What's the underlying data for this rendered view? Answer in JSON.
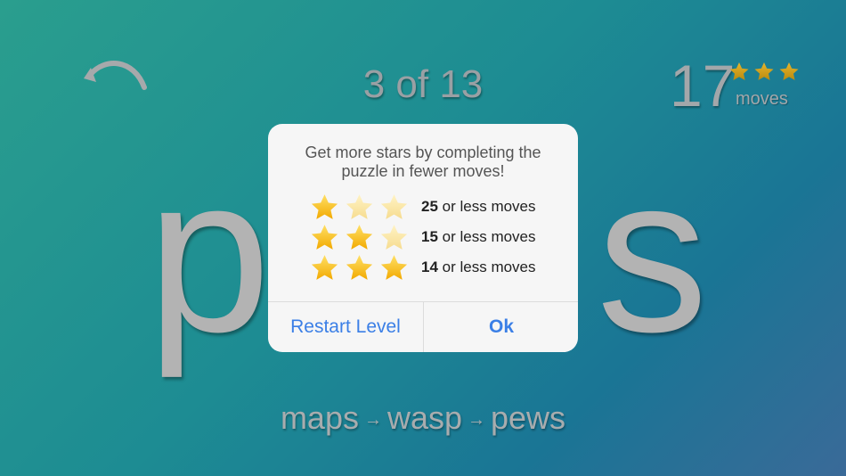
{
  "hud": {
    "level": "3 of 13",
    "moves_count": "17",
    "moves_label": "moves",
    "stars_earned": 3
  },
  "board": {
    "left_letter": "p",
    "right_letter": "s"
  },
  "chain": {
    "words": [
      "maps",
      "wasp",
      "pews"
    ],
    "arrow": "→"
  },
  "dialog": {
    "message_line1": "Get more stars by completing the",
    "message_line2": "puzzle in fewer moves!",
    "rows": [
      {
        "stars": 1,
        "moves": "25",
        "suffix": " or less moves"
      },
      {
        "stars": 2,
        "moves": "15",
        "suffix": " or less moves"
      },
      {
        "stars": 3,
        "moves": "14",
        "suffix": " or less moves"
      }
    ],
    "restart_label": "Restart Level",
    "ok_label": "Ok"
  },
  "colors": {
    "star_gold": "#f5b400",
    "star_faded": "#f8e3a0",
    "button_blue": "#3b7fe6"
  }
}
